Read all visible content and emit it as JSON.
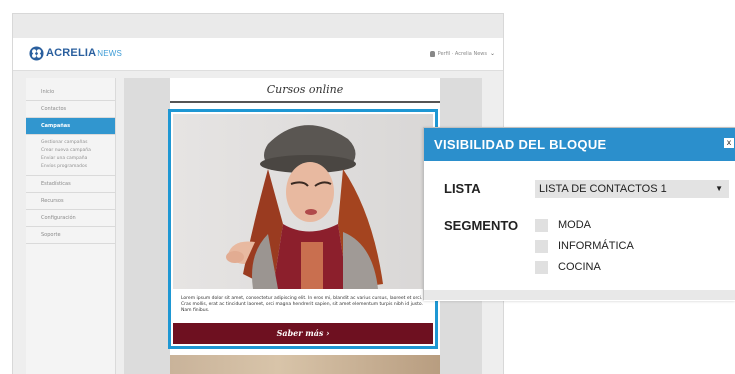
{
  "header": {
    "logo_text": "ACRELIA",
    "logo_sub": "NEWS",
    "profile": "Perfil · Acrelia News"
  },
  "sidebar": {
    "items": [
      {
        "label": "Inicio"
      },
      {
        "label": "Contactos"
      },
      {
        "label": "Campañas"
      },
      {
        "label": "Estadísticas"
      },
      {
        "label": "Recursos"
      },
      {
        "label": "Configuración"
      },
      {
        "label": "Soporte"
      }
    ],
    "subitems": [
      "Gestionar campañas",
      "Crear nueva campaña",
      "Enviar una campaña",
      "Envíos programados"
    ]
  },
  "email": {
    "title": "Cursos online",
    "body": "Lorem ipsum dolor sit amet, consectetur adipiscing elit. In eros mi, blandit ac varius cursus, laoreet et orci. Cras mollis, erat ac tincidunt laoreet, orci magna hendrerit sapien, sit amet elementum turpis nibh id justo. Nam finibus.",
    "cta": "Saber más ›"
  },
  "panel": {
    "title": "VISIBILIDAD DEL BLOQUE",
    "close": "x",
    "list_label": "LISTA",
    "list_value": "LISTA DE CONTACTOS 1",
    "segment_label": "SEGMENTO",
    "segments": [
      "MODA",
      "INFORMÁTICA",
      "COCINA"
    ]
  },
  "colors": {
    "accent": "#2b8fcc",
    "cta": "#6e1020",
    "block_border": "#1e97d3"
  }
}
